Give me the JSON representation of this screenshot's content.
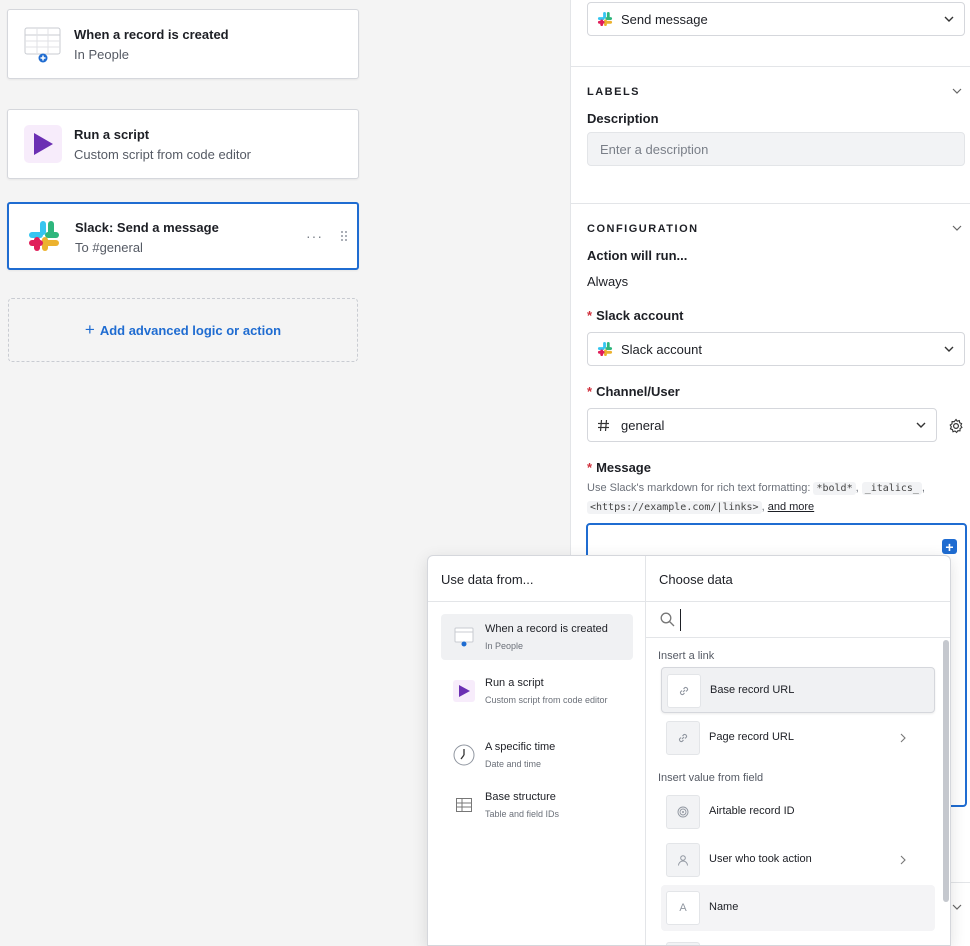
{
  "workflow": {
    "trigger": {
      "title": "When a record is created",
      "subtitle": "In People"
    },
    "script": {
      "title": "Run a script",
      "subtitle": "Custom script from code editor"
    },
    "slack": {
      "title": "Slack: Send a message",
      "subtitle": "To #general",
      "more": "···"
    },
    "add_action": {
      "label": "Add advanced logic or action",
      "plus": "+"
    }
  },
  "panel": {
    "action_select": "Send message",
    "labels_section": "LABELS",
    "description_label": "Description",
    "description_placeholder": "Enter a description",
    "config_section": "CONFIGURATION",
    "action_runs_label": "Action will run...",
    "action_runs_value": "Always",
    "slack_account_label": "Slack account",
    "slack_account_value": "Slack account",
    "channel_label": "Channel/User",
    "channel_value": "general",
    "message_label": "Message",
    "required_mark": "*",
    "hint_prefix": "Use Slack's markdown for rich text formatting:",
    "hint_bold": "*bold*",
    "hint_italics": "_italics_",
    "hint_link": "<https://example.com/|links>",
    "hint_more": "and more",
    "hint_sep": ","
  },
  "popover": {
    "left_header": "Use data from...",
    "right_header": "Choose data",
    "sources": [
      {
        "title": "When a record is created",
        "subtitle": "In People"
      },
      {
        "title": "Run a script",
        "subtitle": "Custom script from code editor"
      },
      {
        "title": "A specific time",
        "subtitle": "Date and time"
      },
      {
        "title": "Base structure",
        "subtitle": "Table and field IDs"
      }
    ],
    "search_value": "",
    "group_link": "Insert a link",
    "group_field": "Insert value from field",
    "options": [
      {
        "label": "Base record URL"
      },
      {
        "label": "Page record URL"
      },
      {
        "label": "Airtable record ID"
      },
      {
        "label": "User who took action"
      },
      {
        "label": "Name",
        "glyph": "A"
      }
    ]
  },
  "colors": {
    "accent": "#1f6cd1",
    "script_purple": "#6b2fb3",
    "required": "#d0303c"
  }
}
